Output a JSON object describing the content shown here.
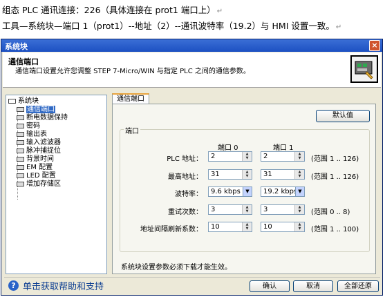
{
  "doc": {
    "line1": "组态 PLC 通讯连接：226（具体连接在 prot1 端口上）",
    "line2": "工具—系统块—端口 1（prot1）--地址（2）--通讯波特率（19.2）与 HMI 设置一致。",
    "mark": "↵"
  },
  "window": {
    "title": "系统块",
    "close": "×"
  },
  "header": {
    "title": "通信端口",
    "description": "通信端口设置允许您调整 STEP 7-Micro/WIN 与指定 PLC 之间的通信参数。"
  },
  "tree": {
    "root": "系统块",
    "items": [
      "通信端口",
      "断电数据保持",
      "密码",
      "输出表",
      "输入滤波器",
      "脉冲捕捉位",
      "背景时间",
      "EM 配置",
      "LED 配置",
      "增加存储区"
    ]
  },
  "tab": {
    "label": "通信端口"
  },
  "panel": {
    "default_button": "默认值",
    "group_title": "端口",
    "port0_header": "端口 0",
    "port1_header": "端口 1",
    "rows": [
      {
        "label": "PLC 地址：",
        "port0": "2",
        "port1": "2",
        "range": "(范围 1 .. 126)"
      },
      {
        "label": "最高地址：",
        "port0": "31",
        "port1": "31",
        "range": "(范围 1 .. 126)"
      },
      {
        "label": "波特率：",
        "port0": "9.6 kbps",
        "port1": "19.2 kbps",
        "range": ""
      },
      {
        "label": "重试次数：",
        "port0": "3",
        "port1": "3",
        "range": "(范围 0 .. 8)"
      },
      {
        "label": "地址间隔刷新系数：",
        "port0": "10",
        "port1": "10",
        "range": "(范围 1 .. 100)"
      }
    ],
    "note": "系统块设置参数必须下载才能生效。"
  },
  "footer": {
    "help": "单击获取帮助和支持",
    "help_icon": "?",
    "ok": "确认",
    "cancel": "取消",
    "restore": "全部还原"
  }
}
